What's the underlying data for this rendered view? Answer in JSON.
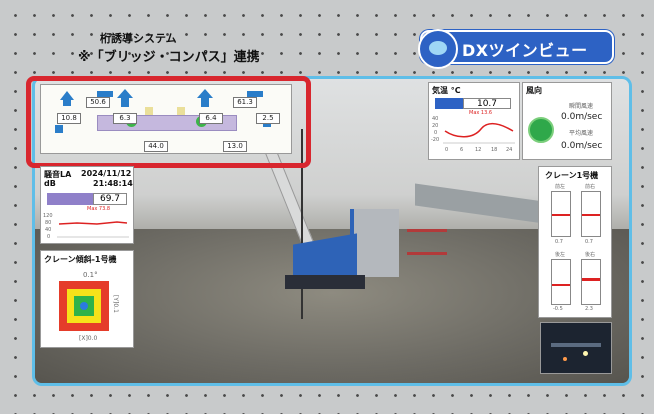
{
  "header": {
    "title_line1": "桁誘導システム",
    "title_line2": "※「ブリッジ・コンパス」連携",
    "logo_text": "DXツインビュー"
  },
  "compass": {
    "values": [
      "50.6",
      "61.3",
      "10.8",
      "6.3",
      "6.4",
      "2.5",
      "44.0",
      "13.0"
    ]
  },
  "temperature": {
    "label": "気温 °C",
    "value": "10.7",
    "max_label": "Max 13.6",
    "yticks": [
      "40",
      "20",
      "0",
      "-20"
    ],
    "xticks": [
      "0",
      "6",
      "12",
      "18",
      "24"
    ]
  },
  "wind": {
    "label": "風向",
    "instant_label": "瞬間風速",
    "instant_value": "0.0m/sec",
    "avg_label": "平均風速",
    "avg_value": "0.0m/sec"
  },
  "noise": {
    "label": "騒音LA",
    "unit": "dB",
    "date": "2024/11/12",
    "time": "21:48:14",
    "value": "69.7",
    "max_label": "Max 73.8",
    "yticks": [
      "120",
      "80",
      "40",
      "0"
    ]
  },
  "crane_tilt": {
    "label": "クレーン傾斜-1号機",
    "top_value": "0.1°",
    "y_label": "[Y]0.1",
    "x_label": "[X]0.0"
  },
  "crane1": {
    "label": "クレーン1号機",
    "gauges": [
      {
        "name": "前左",
        "value": "0.7"
      },
      {
        "name": "前右",
        "value": "0.7"
      },
      {
        "name": "後左",
        "value": "-0.5"
      },
      {
        "name": "後右",
        "value": "2.3"
      }
    ]
  },
  "colors": {
    "frame": "#5fbee8",
    "highlight": "#d8262e",
    "logo": "#2d62c4",
    "tilt_outer": "#e53c2a",
    "tilt_mid": "#f6e21a",
    "tilt_inner": "#2fb24a"
  }
}
